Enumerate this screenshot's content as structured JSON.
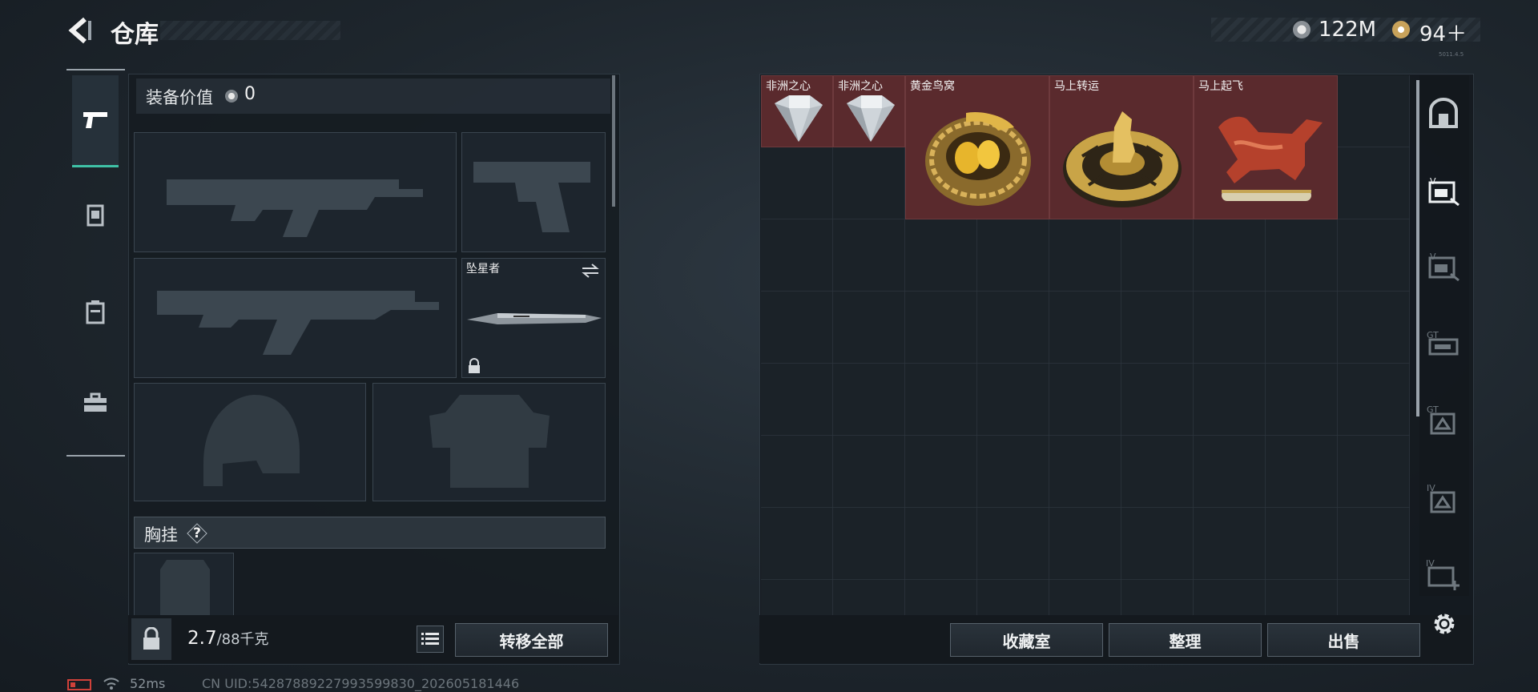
{
  "header": {
    "title": "仓库",
    "currency1_value": "122M",
    "currency2_value": "94＋",
    "version": "5011.4.5"
  },
  "loadout": {
    "value_label": "装备价值",
    "value": "0",
    "melee_name": "坠星者",
    "chest_label": "胸挂",
    "chest_help": "?",
    "weight_current": "2.7",
    "weight_max": "/88千克",
    "transfer_all": "转移全部"
  },
  "stash": {
    "items": [
      {
        "label": "非洲之心"
      },
      {
        "label": "非洲之心"
      },
      {
        "label": "黄金鸟窝"
      },
      {
        "label": "马上转运"
      },
      {
        "label": "马上起飞"
      }
    ],
    "btn_collection": "收藏室",
    "btn_sort": "整理",
    "btn_sell": "出售"
  },
  "status": {
    "ping": "52ms",
    "uid": "CN UID:54287889227993599830_202605181446"
  },
  "colors": {
    "accent": "#3fc1a6",
    "item_bg": "#5a2a2d",
    "panel": "#161c22"
  }
}
